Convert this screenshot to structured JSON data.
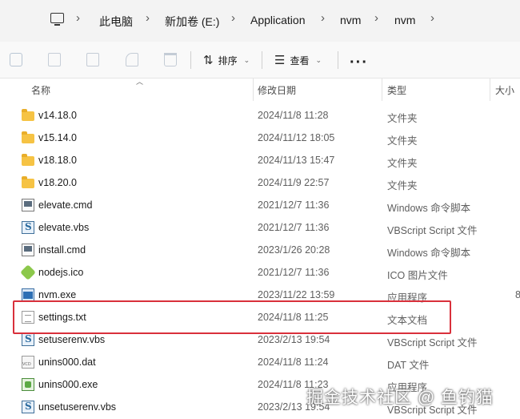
{
  "address_bar": {
    "crumbs": [
      "此电脑",
      "新加卷 (E:)",
      "Application",
      "nvm",
      "nvm"
    ]
  },
  "toolbar": {
    "sort_label": "排序",
    "view_label": "查看",
    "more_label": "···",
    "disabled_actions": [
      "copy-icon",
      "paste-icon",
      "rename-icon",
      "share-icon",
      "delete-icon"
    ]
  },
  "columns": {
    "name": "名称",
    "modified": "修改日期",
    "type": "类型",
    "size": "大小"
  },
  "files": [
    {
      "name": "v14.18.0",
      "date": "2024/11/8 11:28",
      "type": "文件夹",
      "size": "",
      "icon": "folder-icon"
    },
    {
      "name": "v15.14.0",
      "date": "2024/11/12 18:05",
      "type": "文件夹",
      "size": "",
      "icon": "folder-icon"
    },
    {
      "name": "v18.18.0",
      "date": "2024/11/13 15:47",
      "type": "文件夹",
      "size": "",
      "icon": "folder-icon"
    },
    {
      "name": "v18.20.0",
      "date": "2024/11/9 22:57",
      "type": "文件夹",
      "size": "",
      "icon": "folder-icon"
    },
    {
      "name": "elevate.cmd",
      "date": "2021/12/7 11:36",
      "type": "Windows 命令脚本",
      "size": "",
      "icon": "cmd-file-icon"
    },
    {
      "name": "elevate.vbs",
      "date": "2021/12/7 11:36",
      "type": "VBScript Script 文件",
      "size": "",
      "icon": "vbs-file-icon"
    },
    {
      "name": "install.cmd",
      "date": "2023/1/26 20:28",
      "type": "Windows 命令脚本",
      "size": "",
      "icon": "cmd-file-icon"
    },
    {
      "name": "nodejs.ico",
      "date": "2021/12/7 11:36",
      "type": "ICO 图片文件",
      "size": "",
      "icon": "nodejs-icon"
    },
    {
      "name": "nvm.exe",
      "date": "2023/11/22 13:59",
      "type": "应用程序",
      "size": "8",
      "icon": "exe-icon"
    },
    {
      "name": "settings.txt",
      "date": "2024/11/8 11:25",
      "type": "文本文档",
      "size": "",
      "icon": "text-file-icon"
    },
    {
      "name": "setuserenv.vbs",
      "date": "2023/2/13 19:54",
      "type": "VBScript Script 文件",
      "size": "",
      "icon": "vbs-file-icon"
    },
    {
      "name": "unins000.dat",
      "date": "2024/11/8 11:24",
      "type": "DAT 文件",
      "size": "",
      "icon": "dat-file-icon"
    },
    {
      "name": "unins000.exe",
      "date": "2024/11/8 11:23",
      "type": "应用程序",
      "size": "",
      "icon": "installer-icon"
    },
    {
      "name": "unsetuserenv.vbs",
      "date": "2023/2/13 19:54",
      "type": "VBScript Script 文件",
      "size": "",
      "icon": "vbs-file-icon"
    }
  ],
  "highlighted_file": "settings.txt",
  "colors": {
    "highlight_border": "#d9303b",
    "folder": "#f6c344"
  },
  "watermark": "掘金技术社区 @ 鱼钓猫"
}
